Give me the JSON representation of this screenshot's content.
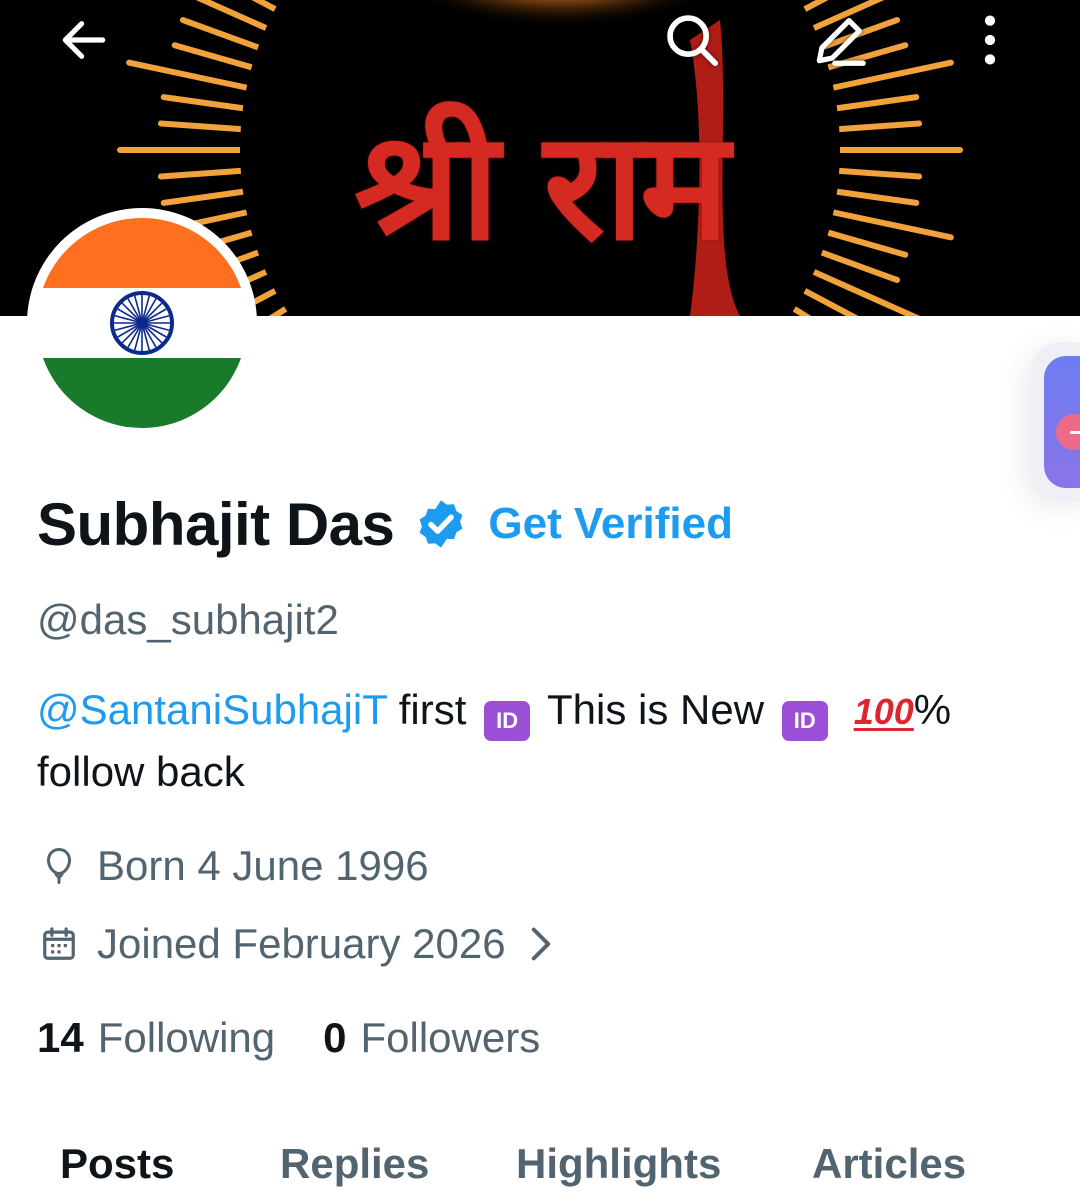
{
  "banner": {
    "title": "श्री राम",
    "colors": {
      "background": "#000000",
      "rays": "#f2a23a",
      "title": "#d42a22"
    }
  },
  "topbar": {
    "back_icon": "arrow-left-icon",
    "search_icon": "search-icon",
    "edit_icon": "edit-icon",
    "more_icon": "more-vertical-icon"
  },
  "avatar": {
    "image": "india-flag",
    "colors": [
      "#ff6f1f",
      "#ffffff",
      "#1a7a2c",
      "#0b2a8a"
    ]
  },
  "profile": {
    "display_name": "Subhajit Das",
    "verified_icon": "verified-badge-icon",
    "get_verified": "Get Verified",
    "handle": "@das_subhajit2",
    "bio": {
      "mention": "@SantaniSubhajiT",
      "text1": " first ",
      "id_emoji": "ID",
      "text2": "  This is New ",
      "hundred_emoji": "100",
      "text3": "%",
      "line2": "follow back"
    },
    "born": "Born 4 June 1996",
    "joined": "Joined February 2026",
    "following_count": "14",
    "following_label": "Following",
    "followers_count": "0",
    "followers_label": "Followers"
  },
  "tabs": [
    {
      "label": "Posts",
      "active": true
    },
    {
      "label": "Replies",
      "active": false
    },
    {
      "label": "Highlights",
      "active": false
    },
    {
      "label": "Articles",
      "active": false
    }
  ],
  "accent": "#1d9bf0"
}
